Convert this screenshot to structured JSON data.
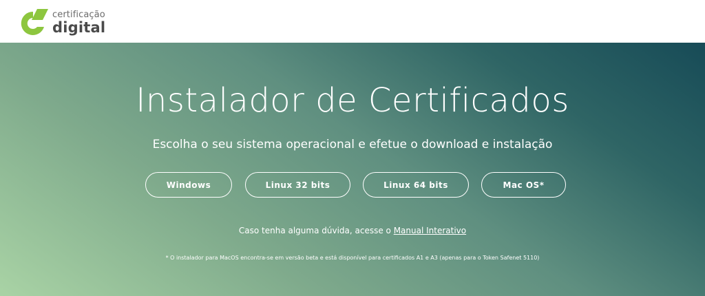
{
  "brand": {
    "line1": "certificação",
    "line2": "digital",
    "colors": {
      "green": "#8dc63f",
      "dark": "#4a4a4a"
    }
  },
  "hero": {
    "title": "Instalador de Certificados",
    "subtitle": "Escolha o seu sistema operacional e efetue o download e instalação",
    "buttons": [
      {
        "label": "Windows"
      },
      {
        "label": "Linux 32 bits"
      },
      {
        "label": "Linux 64 bits"
      },
      {
        "label": "Mac OS*"
      }
    ],
    "help_prefix": "Caso tenha alguma dúvida, acesse o ",
    "help_link": "Manual Interativo",
    "note": "* O instalador para MacOS encontra-se em versão beta e está disponível para certificados A1 e A3 (apenas para o Token Safenet 5110)"
  }
}
